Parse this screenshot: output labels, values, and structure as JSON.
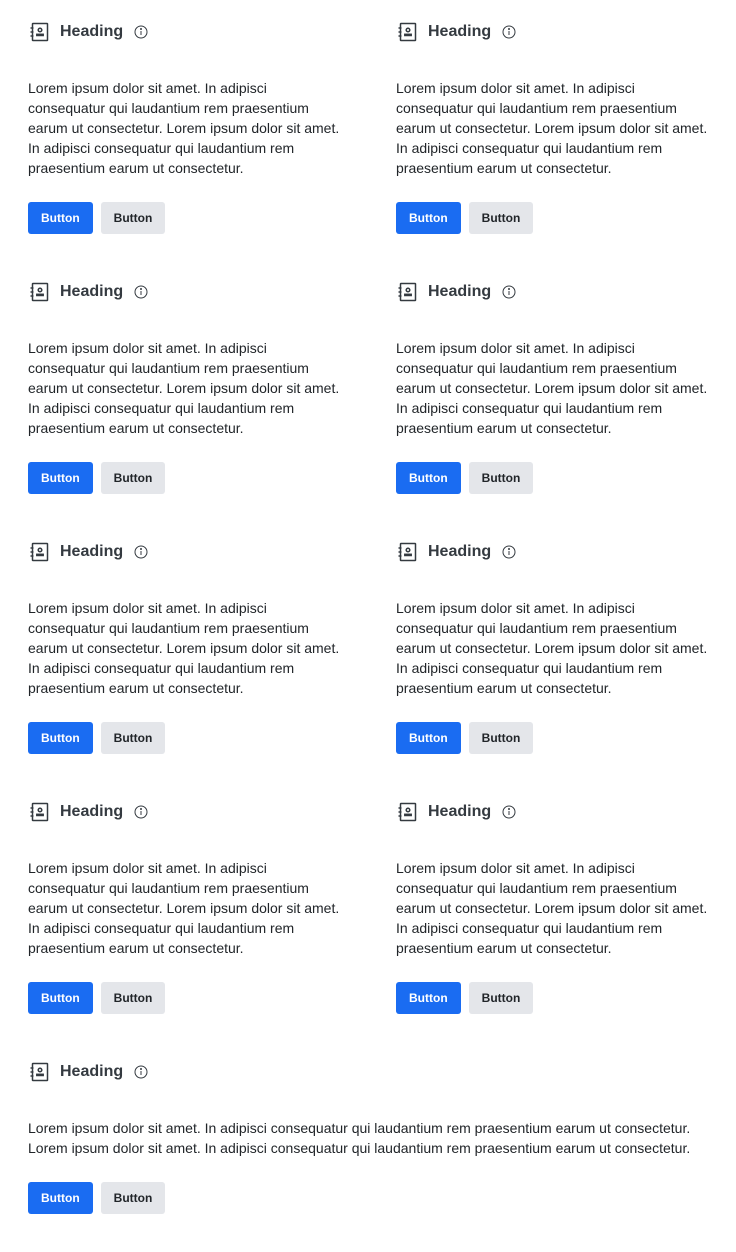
{
  "colors": {
    "primary": "#1a6cf2",
    "secondary": "#e4e6ea",
    "heading": "#343a40",
    "text": "#212529"
  },
  "cards": [
    {
      "icon": "contact-book-icon",
      "heading": "Heading",
      "info_icon": "info-icon",
      "body": "Lorem ipsum dolor sit amet. In adipisci consequatur qui laudantium rem praesentium earum ut consectetur. Lorem ipsum dolor sit amet. In adipisci consequatur qui laudantium rem praesentium earum ut consectetur.",
      "primary_button": "Button",
      "secondary_button": "Button"
    },
    {
      "icon": "contact-book-icon",
      "heading": "Heading",
      "info_icon": "info-icon",
      "body": "Lorem ipsum dolor sit amet. In adipisci consequatur qui laudantium rem praesentium earum ut consectetur. Lorem ipsum dolor sit amet. In adipisci consequatur qui laudantium rem praesentium earum ut consectetur.",
      "primary_button": "Button",
      "secondary_button": "Button"
    },
    {
      "icon": "contact-book-icon",
      "heading": "Heading",
      "info_icon": "info-icon",
      "body": "Lorem ipsum dolor sit amet. In adipisci consequatur qui laudantium rem praesentium earum ut consectetur. Lorem ipsum dolor sit amet. In adipisci consequatur qui laudantium rem praesentium earum ut consectetur.",
      "primary_button": "Button",
      "secondary_button": "Button"
    },
    {
      "icon": "contact-book-icon",
      "heading": "Heading",
      "info_icon": "info-icon",
      "body": "Lorem ipsum dolor sit amet. In adipisci consequatur qui laudantium rem praesentium earum ut consectetur. Lorem ipsum dolor sit amet. In adipisci consequatur qui laudantium rem praesentium earum ut consectetur.",
      "primary_button": "Button",
      "secondary_button": "Button"
    },
    {
      "icon": "contact-book-icon",
      "heading": "Heading",
      "info_icon": "info-icon",
      "body": "Lorem ipsum dolor sit amet. In adipisci consequatur qui laudantium rem praesentium earum ut consectetur. Lorem ipsum dolor sit amet. In adipisci consequatur qui laudantium rem praesentium earum ut consectetur.",
      "primary_button": "Button",
      "secondary_button": "Button"
    },
    {
      "icon": "contact-book-icon",
      "heading": "Heading",
      "info_icon": "info-icon",
      "body": "Lorem ipsum dolor sit amet. In adipisci consequatur qui laudantium rem praesentium earum ut consectetur. Lorem ipsum dolor sit amet. In adipisci consequatur qui laudantium rem praesentium earum ut consectetur.",
      "primary_button": "Button",
      "secondary_button": "Button"
    },
    {
      "icon": "contact-book-icon",
      "heading": "Heading",
      "info_icon": "info-icon",
      "body": "Lorem ipsum dolor sit amet. In adipisci consequatur qui laudantium rem praesentium earum ut consectetur. Lorem ipsum dolor sit amet. In adipisci consequatur qui laudantium rem praesentium earum ut consectetur.",
      "primary_button": "Button",
      "secondary_button": "Button"
    },
    {
      "icon": "contact-book-icon",
      "heading": "Heading",
      "info_icon": "info-icon",
      "body": "Lorem ipsum dolor sit amet. In adipisci consequatur qui laudantium rem praesentium earum ut consectetur. Lorem ipsum dolor sit amet. In adipisci consequatur qui laudantium rem praesentium earum ut consectetur.",
      "primary_button": "Button",
      "secondary_button": "Button"
    },
    {
      "icon": "contact-book-icon",
      "heading": "Heading",
      "info_icon": "info-icon",
      "body": "Lorem ipsum dolor sit amet. In adipisci consequatur qui laudantium rem praesentium earum ut consectetur. Lorem ipsum dolor sit amet. In adipisci consequatur qui laudantium rem praesentium earum ut consectetur.",
      "primary_button": "Button",
      "secondary_button": "Button"
    }
  ]
}
